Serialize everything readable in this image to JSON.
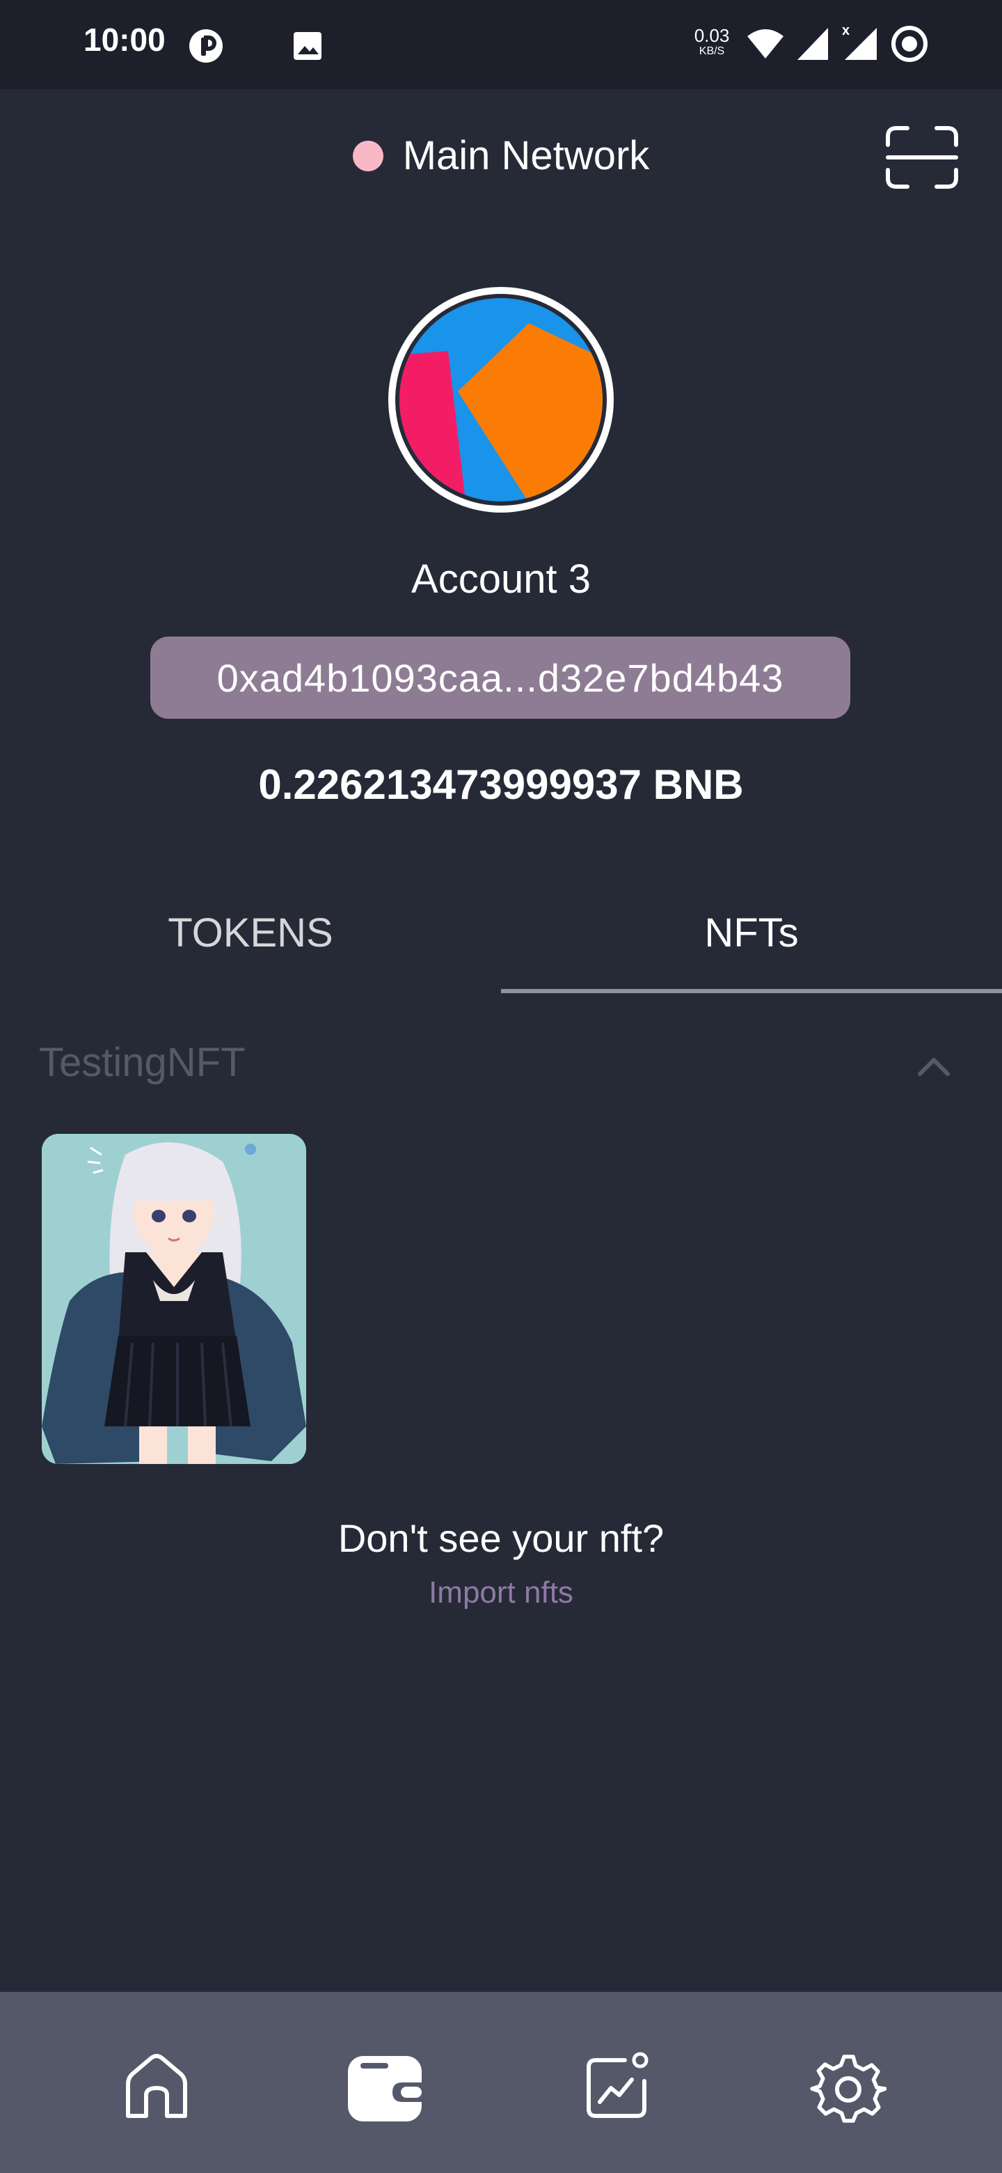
{
  "status_bar": {
    "time": "10:00",
    "net_speed_value": "0.03",
    "net_speed_unit": "KB/S",
    "icons": [
      "notification-icon",
      "image-icon",
      "wifi-icon",
      "signal-icon",
      "signal-no-data-icon",
      "record-icon"
    ]
  },
  "header": {
    "network_label": "Main Network",
    "network_dot_color": "#f9b8c6",
    "scan_icon": "scan-icon"
  },
  "account": {
    "name": "Account 3",
    "address": "0xad4b1093caa...d32e7bd4b43",
    "balance": "0.226213473999937 BNB"
  },
  "tabs": [
    {
      "label": "TOKENS",
      "active": false
    },
    {
      "label": "NFTs",
      "active": true
    }
  ],
  "collection": {
    "title": "TestingNFT",
    "expanded": true
  },
  "empty_hint": {
    "question": "Don't see your nft?",
    "link": "Import nfts"
  },
  "bottom_nav": [
    {
      "icon": "home-icon",
      "active": false
    },
    {
      "icon": "wallet-icon",
      "active": true
    },
    {
      "icon": "activity-chart-icon",
      "active": false
    },
    {
      "icon": "settings-gear-icon",
      "active": false
    }
  ],
  "colors": {
    "background": "#262a37",
    "status_bar": "#1d202b",
    "address_pill": "#8e7c94",
    "link": "#8e7aa4",
    "bottom_nav": "#555869"
  }
}
